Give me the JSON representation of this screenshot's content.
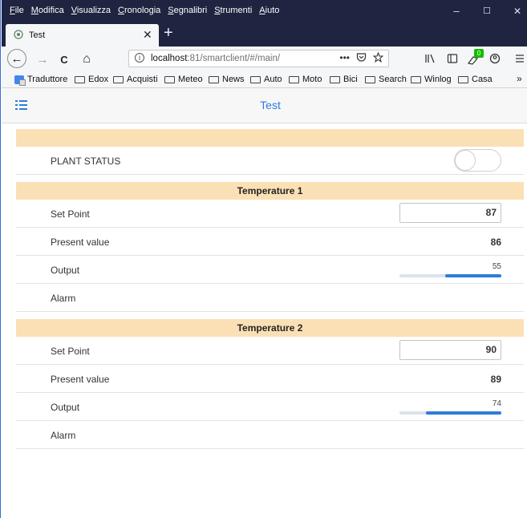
{
  "menu": [
    "File",
    "Modifica",
    "Visualizza",
    "Cronologia",
    "Segnalibri",
    "Strumenti",
    "Aiuto"
  ],
  "window_controls": {
    "minimize": "–",
    "maximize": "☐",
    "close": "✕"
  },
  "tab": {
    "title": "Test",
    "close": "✕",
    "new": "+"
  },
  "nav": {
    "back": "←",
    "forward": "→",
    "reload": "C",
    "home": "⌂",
    "url_host": "localhost",
    "url_path": ":81/smartclient/#/main/",
    "page_actions": "•••",
    "addon_badge": "0"
  },
  "bookmarks": [
    "Traduttore",
    "Edox",
    "Acquisti",
    "Meteo",
    "News",
    "Auto",
    "Moto",
    "Bici",
    "Search",
    "Winlog",
    "Casa"
  ],
  "bookmarks_more": "»",
  "app": {
    "title": "Test"
  },
  "plant": {
    "label": "PLANT STATUS",
    "on": false
  },
  "sections": [
    {
      "title": "Temperature 1",
      "setpoint_label": "Set Point",
      "setpoint": "87",
      "present_label": "Present value",
      "present": "86",
      "output_label": "Output",
      "output": "55",
      "output_fraction": 0.55,
      "alarm_label": "Alarm"
    },
    {
      "title": "Temperature 2",
      "setpoint_label": "Set Point",
      "setpoint": "90",
      "present_label": "Present value",
      "present": "89",
      "output_label": "Output",
      "output": "74",
      "output_fraction": 0.74,
      "alarm_label": "Alarm"
    }
  ],
  "colors": {
    "accent": "#2e7bdc",
    "section_bg": "#fbe0b6",
    "titlebar": "#1f2440",
    "addon_badge": "#12bc00"
  }
}
